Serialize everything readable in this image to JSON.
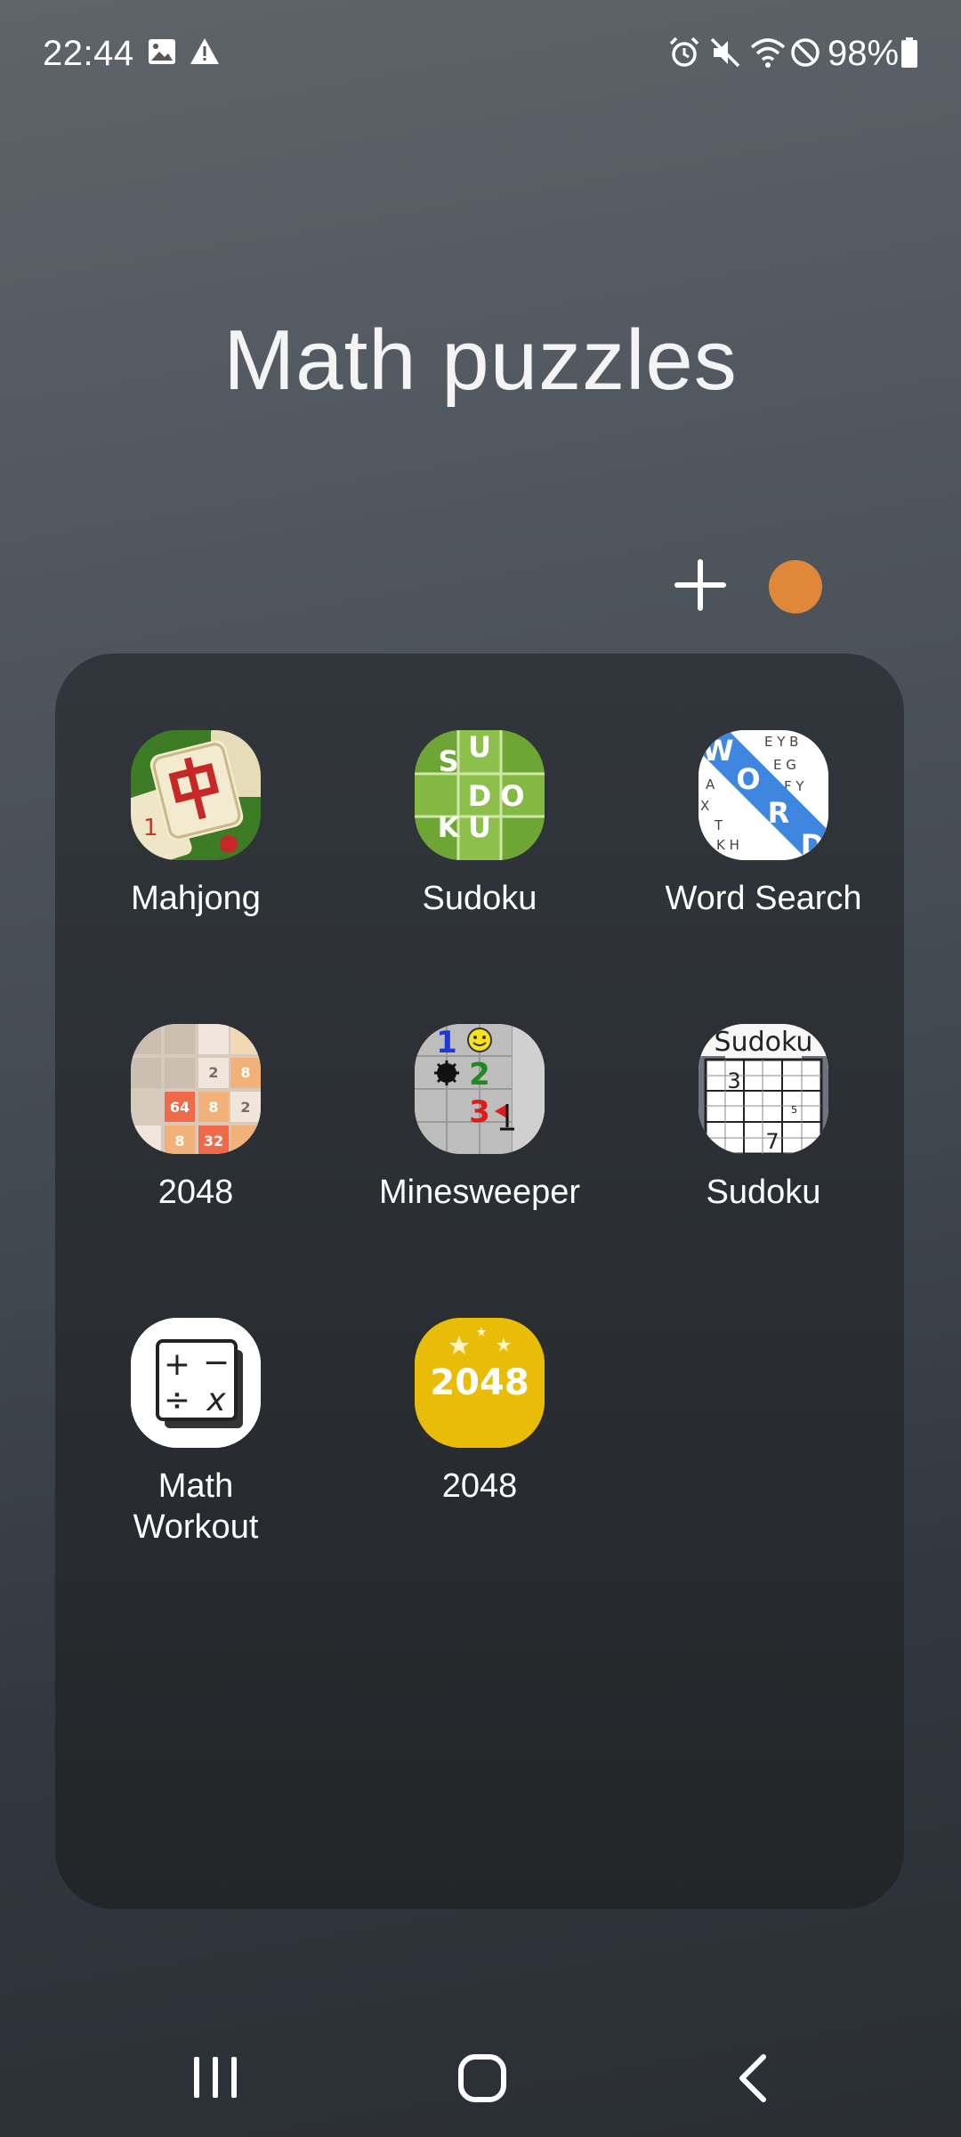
{
  "status_bar": {
    "time": "22:44",
    "left_icons": [
      "image-icon",
      "warning-icon"
    ],
    "right_icons": [
      "alarm-icon",
      "mute-icon",
      "wifi-icon",
      "do-not-disturb-icon",
      "battery-icon"
    ],
    "battery_percent": "98%"
  },
  "folder": {
    "title": "Math puzzles",
    "color": "#e0883a",
    "apps": [
      {
        "label": "Mahjong",
        "icon": "mahjong-icon"
      },
      {
        "label": "Sudoku",
        "icon": "sudoku-green-icon",
        "icon_text": [
          "S",
          "U",
          "D",
          "O",
          "K",
          "U"
        ]
      },
      {
        "label": "Word Search",
        "icon": "word-search-icon",
        "icon_text": "WORD"
      },
      {
        "label": "2048",
        "icon": "2048-tiles-icon",
        "tiles": [
          "2",
          "8",
          "64",
          "8",
          "2",
          "8",
          "32"
        ]
      },
      {
        "label": "Minesweeper",
        "icon": "minesweeper-icon",
        "digits": [
          "1",
          "2",
          "3"
        ]
      },
      {
        "label": "Sudoku",
        "icon": "sudoku-grid-icon",
        "icon_title": "Sudoku",
        "digits": [
          "3",
          "7",
          "5"
        ]
      },
      {
        "label_line1": "Math",
        "label_line2": "Workout",
        "icon": "math-workout-icon",
        "symbols": [
          "+",
          "−",
          "÷",
          "x"
        ]
      },
      {
        "label": "2048",
        "icon": "2048-yellow-icon",
        "icon_text": "2048"
      }
    ]
  },
  "nav_bar": {
    "recents": "recents-icon",
    "home": "home-icon",
    "back": "back-icon"
  }
}
